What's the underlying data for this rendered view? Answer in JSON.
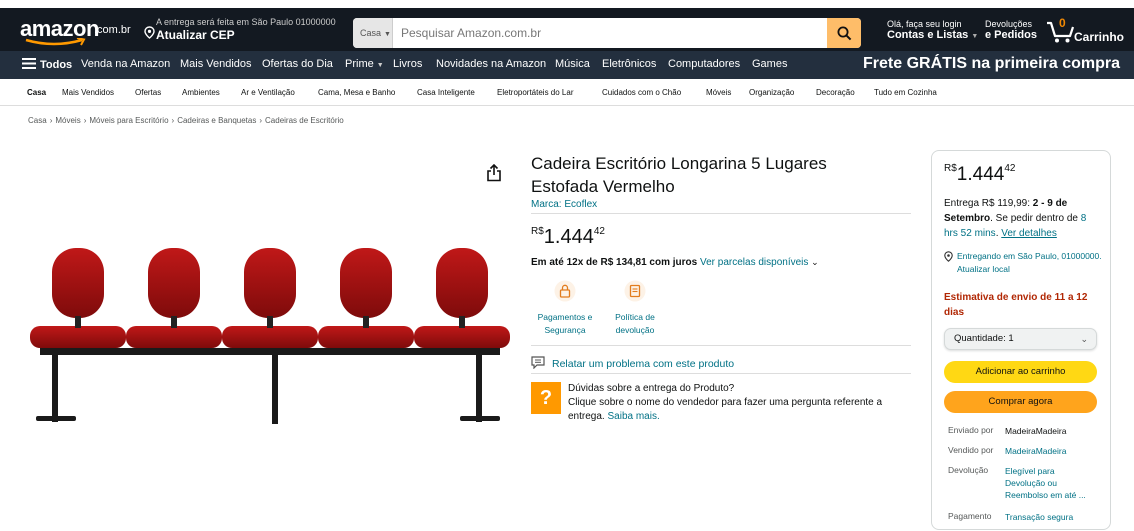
{
  "colors": {
    "nav_dark": "#131921",
    "nav_secondary": "#232f3e",
    "search_button": "#febd69",
    "link": "#007185",
    "price_text": "#0f1111",
    "estimate_red": "#b12704",
    "add_to_cart": "#ffd814",
    "buy_now": "#ffa41c",
    "question_icon": "#ff9900"
  },
  "header": {
    "logo_text": "amazon",
    "logo_tld": ".com.br",
    "location_line1": "A entrega será feita em São Paulo 01000000",
    "location_line2": "Atualizar CEP",
    "search_category": "Casa",
    "search_placeholder": "Pesquisar Amazon.com.br",
    "account_line1": "Olá, faça seu login",
    "account_line2": "Contas e Listas",
    "returns_line1": "Devoluções",
    "returns_line2": "e Pedidos",
    "cart_count": "0",
    "cart_label": "Carrinho"
  },
  "main_nav": {
    "all_label": "Todos",
    "items": [
      "Venda na Amazon",
      "Mais Vendidos",
      "Ofertas do Dia",
      "Prime",
      "Livros",
      "Novidades na Amazon",
      "Música",
      "Eletrônicos",
      "Computadores",
      "Games"
    ],
    "promo": "Frete GRÁTIS na primeira compra"
  },
  "sub_nav": {
    "items": [
      "Casa",
      "Mais Vendidos",
      "Ofertas",
      "Ambientes",
      "Ar e Ventilação",
      "Cama, Mesa e Banho",
      "Casa Inteligente",
      "Eletroportáteis do Lar",
      "Cuidados com o Chão",
      "Móveis",
      "Organização",
      "Decoração",
      "Tudo em Cozinha"
    ]
  },
  "breadcrumb": [
    "Casa",
    "Móveis",
    "Móveis para Escritório",
    "Cadeiras e Banquetas",
    "Cadeiras de Escritório"
  ],
  "product": {
    "title": "Cadeira Escritório Longarina 5 Lugares Estofada Vermelho",
    "brand_link": "Marca: Ecoflex",
    "price_currency": "R$",
    "price_int": "1.444",
    "price_dec": "42",
    "install_bold": "Em até 12x de R$ 134,81 com juros",
    "install_link": "Ver parcelas disponíveis",
    "features": [
      {
        "icon": "lock-icon",
        "label": "Pagamentos e Segurança"
      },
      {
        "icon": "return-policy-icon",
        "label": "Política de devolução"
      }
    ],
    "report_link": "Relatar um problema com este produto",
    "question_line": "Dúvidas sobre a entrega do Produto?",
    "question_body": "Clique sobre o nome do vendedor para fazer uma pergunta referente a entrega.",
    "question_link": "Saiba mais."
  },
  "buybox": {
    "price_currency": "R$",
    "price_int": "1.444",
    "price_dec": "42",
    "delivery_prefix": "Entrega R$ 119,99:",
    "delivery_dates": "2 - 9 de Setembro",
    "delivery_mid": ". Se pedir dentro de",
    "delivery_time": "8 hrs 52 mins",
    "delivery_link": "Ver detalhes",
    "location": "Entregando em São Paulo, 01000000. Atualizar local",
    "estimate": "Estimativa de envio de 11 a 12 dias",
    "quantity": "Quantidade: 1",
    "add_to_cart": "Adicionar ao carrinho",
    "buy_now": "Comprar agora",
    "shipped_by_label": "Enviado por",
    "shipped_by_value": "MadeiraMadeira",
    "sold_by_label": "Vendido por",
    "sold_by_value": "MadeiraMadeira",
    "return_label": "Devolução",
    "return_value": "Elegível para Devolução ou Reembolso em até ...",
    "payment_label": "Pagamento",
    "payment_value": "Transação segura"
  }
}
